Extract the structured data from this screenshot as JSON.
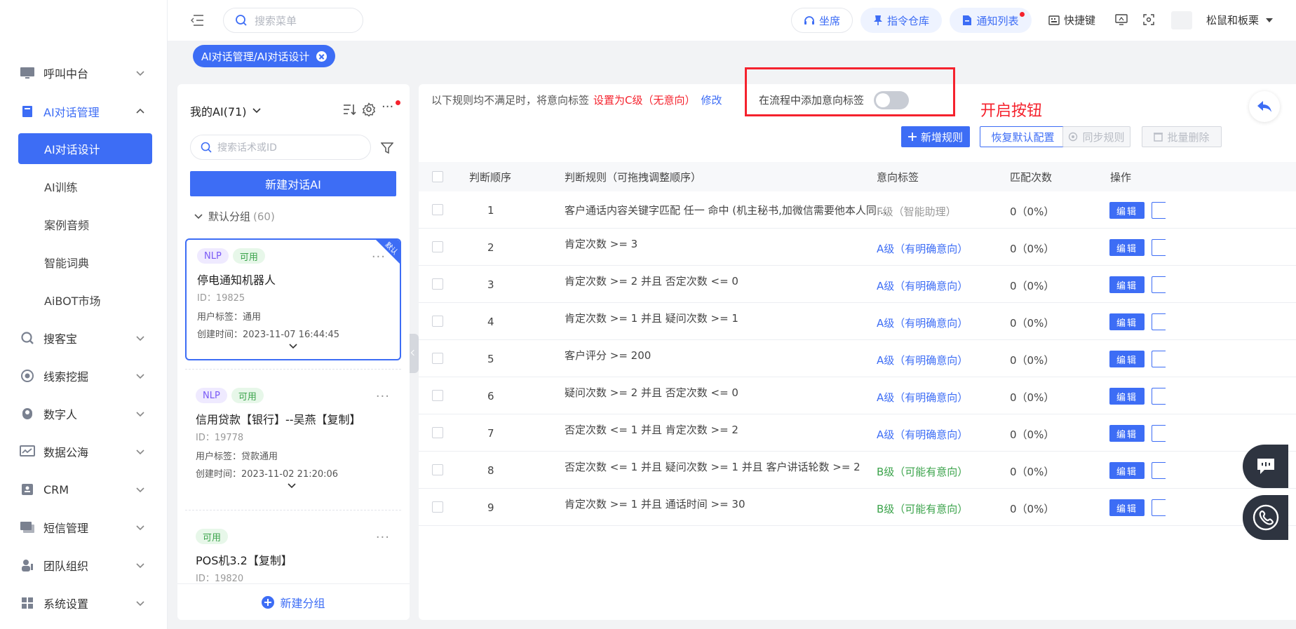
{
  "sidebar": {
    "items": [
      {
        "label": "呼叫中台",
        "icon": "monitor-icon"
      },
      {
        "label": "AI对话管理",
        "icon": "book-icon"
      },
      {
        "label": "搜客宝",
        "icon": "search-zoom-icon"
      },
      {
        "label": "线索挖掘",
        "icon": "target-icon"
      },
      {
        "label": "数字人",
        "icon": "person-icon"
      },
      {
        "label": "数据公海",
        "icon": "chart-icon"
      },
      {
        "label": "CRM",
        "icon": "contact-icon"
      },
      {
        "label": "短信管理",
        "icon": "message-icon"
      },
      {
        "label": "团队组织",
        "icon": "team-icon"
      },
      {
        "label": "系统设置",
        "icon": "grid-icon"
      }
    ],
    "sub_items": [
      "AI对话设计",
      "AI训练",
      "案例音频",
      "智能词典",
      "AiBOT市场"
    ]
  },
  "header": {
    "search_placeholder": "搜索菜单",
    "pills": [
      "坐席",
      "指令仓库",
      "通知列表"
    ],
    "shortcut": "快捷键",
    "user": "松鼠和板栗"
  },
  "breadcrumb_tag": "AI对话管理/AI对话设计",
  "left_panel": {
    "title": "我的AI(71)",
    "search_placeholder": "搜索话术或ID",
    "new_button": "新建对话AI",
    "group_name": "默认分组",
    "group_count": "(60)",
    "corner_label": "默认",
    "cards": [
      {
        "badges": [
          "NLP",
          "可用"
        ],
        "name": "停电通知机器人",
        "id": "ID：19825",
        "user_label": "用户标签：通用",
        "created": "创建时间：2023-11-07 16:44:45"
      },
      {
        "badges": [
          "NLP",
          "可用"
        ],
        "name": "信用贷款【银行】--吴燕【复制】",
        "id": "ID：19778",
        "user_label": "用户标签：贷款通用",
        "created": "创建时间：2023-11-02 21:20:06"
      },
      {
        "badges": [
          "可用"
        ],
        "name": "POS机3.2【复制】",
        "id": "ID：19820"
      }
    ],
    "footer": "新建分组"
  },
  "right_panel": {
    "note_prefix": "以下规则均不满足时，将意向标签",
    "note_red": "设置为C级（无意向）",
    "note_link": "修改",
    "flow_label": "在流程中添加意向标签",
    "open_note": "开启按钮",
    "buttons": {
      "add": "新增规则",
      "reset": "恢复默认配置",
      "sync": "同步规则",
      "batch_delete": "批量删除"
    },
    "columns": [
      "判断顺序",
      "判断规则（可拖拽调整顺序）",
      "意向标签",
      "匹配次数",
      "操作"
    ],
    "edit_label": "编辑",
    "rows": [
      {
        "order": "1",
        "rule": "客户通话内容关键字匹配 任一 命中 (机主秘书,加微信需要他本人同意我不能擅自回复",
        "tag": "F级（智能助理）",
        "grade": "F",
        "count": "0（0%）"
      },
      {
        "order": "2",
        "rule": "肯定次数 >= 3",
        "tag": "A级（有明确意向）",
        "grade": "A",
        "count": "0（0%）"
      },
      {
        "order": "3",
        "rule": "肯定次数 >= 2 并且 否定次数 <= 0",
        "tag": "A级（有明确意向）",
        "grade": "A",
        "count": "0（0%）"
      },
      {
        "order": "4",
        "rule": "肯定次数 >= 1 并且 疑问次数 >= 1",
        "tag": "A级（有明确意向）",
        "grade": "A",
        "count": "0（0%）"
      },
      {
        "order": "5",
        "rule": "客户评分 >= 200",
        "tag": "A级（有明确意向）",
        "grade": "A",
        "count": "0（0%）"
      },
      {
        "order": "6",
        "rule": "疑问次数 >= 2 并且 否定次数 <= 0",
        "tag": "A级（有明确意向）",
        "grade": "A",
        "count": "0（0%）"
      },
      {
        "order": "7",
        "rule": "否定次数 <= 1 并且 肯定次数 >= 2",
        "tag": "A级（有明确意向）",
        "grade": "A",
        "count": "0（0%）"
      },
      {
        "order": "8",
        "rule": "否定次数 <= 1 并且 疑问次数 >= 1 并且 客户讲话轮数 >= 2",
        "tag": "B级（可能有意向）",
        "grade": "B",
        "count": "0（0%）"
      },
      {
        "order": "9",
        "rule": "肯定次数 >= 1 并且 通话时间 >= 30",
        "tag": "B级（可能有意向）",
        "grade": "B",
        "count": "0（0%）"
      }
    ]
  },
  "colors": {
    "primary": "#3d6df5",
    "danger": "#f5222d",
    "success": "#3ba34b"
  }
}
